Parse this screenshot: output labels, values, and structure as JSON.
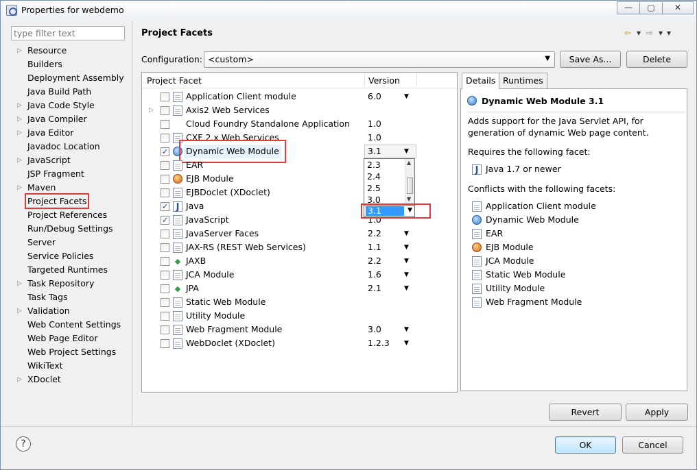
{
  "window": {
    "title": "Properties for webdemo",
    "controls": {
      "minimize": "—",
      "maximize": "▢",
      "close": "✕"
    }
  },
  "filter": {
    "placeholder": "type filter text"
  },
  "nav": {
    "items": [
      {
        "label": "Resource",
        "expandable": true
      },
      {
        "label": "Builders",
        "expandable": false
      },
      {
        "label": "Deployment Assembly",
        "expandable": false
      },
      {
        "label": "Java Build Path",
        "expandable": false
      },
      {
        "label": "Java Code Style",
        "expandable": true
      },
      {
        "label": "Java Compiler",
        "expandable": true
      },
      {
        "label": "Java Editor",
        "expandable": true
      },
      {
        "label": "Javadoc Location",
        "expandable": false
      },
      {
        "label": "JavaScript",
        "expandable": true
      },
      {
        "label": "JSP Fragment",
        "expandable": false
      },
      {
        "label": "Maven",
        "expandable": true
      },
      {
        "label": "Project Facets",
        "expandable": false,
        "selected": true
      },
      {
        "label": "Project References",
        "expandable": false
      },
      {
        "label": "Run/Debug Settings",
        "expandable": false
      },
      {
        "label": "Server",
        "expandable": false
      },
      {
        "label": "Service Policies",
        "expandable": false
      },
      {
        "label": "Targeted Runtimes",
        "expandable": false
      },
      {
        "label": "Task Repository",
        "expandable": true
      },
      {
        "label": "Task Tags",
        "expandable": false
      },
      {
        "label": "Validation",
        "expandable": true
      },
      {
        "label": "Web Content Settings",
        "expandable": false
      },
      {
        "label": "Web Page Editor",
        "expandable": false
      },
      {
        "label": "Web Project Settings",
        "expandable": false
      },
      {
        "label": "WikiText",
        "expandable": false
      },
      {
        "label": "XDoclet",
        "expandable": true
      }
    ]
  },
  "page": {
    "title": "Project Facets",
    "nav_arrows": {
      "back": "⇦",
      "forward": "⇨",
      "caret": "▾",
      "menu": "▾"
    }
  },
  "configuration": {
    "label": "Configuration:",
    "value": "<custom>",
    "save_as": "Save As...",
    "delete": "Delete"
  },
  "facets": {
    "columns": {
      "facet": "Project Facet",
      "version": "Version"
    },
    "rows": [
      {
        "name": "Application Client module",
        "version": "6.0",
        "checked": false,
        "icon": "doc",
        "dropdown": true,
        "expandable": false
      },
      {
        "name": "Axis2 Web Services",
        "version": "",
        "checked": false,
        "icon": "doc",
        "dropdown": false,
        "expandable": true
      },
      {
        "name": "Cloud Foundry Standalone Application",
        "version": "1.0",
        "checked": false,
        "icon": "none",
        "dropdown": false,
        "expandable": false
      },
      {
        "name": "CXF 2.x Web Services",
        "version": "1.0",
        "checked": false,
        "icon": "doc",
        "dropdown": false,
        "expandable": false
      },
      {
        "name": "Dynamic Web Module",
        "version": "3.1",
        "checked": true,
        "icon": "globe",
        "dropdown": true,
        "expandable": false,
        "selected": true
      },
      {
        "name": "EAR",
        "version": "",
        "checked": false,
        "icon": "doc",
        "dropdown": false,
        "expandable": false
      },
      {
        "name": "EJB Module",
        "version": "",
        "checked": false,
        "icon": "bean",
        "dropdown": false,
        "expandable": false
      },
      {
        "name": "EJBDoclet (XDoclet)",
        "version": "",
        "checked": false,
        "icon": "doc",
        "dropdown": false,
        "expandable": false
      },
      {
        "name": "Java",
        "version": "",
        "checked": true,
        "icon": "java",
        "dropdown": false,
        "expandable": false
      },
      {
        "name": "JavaScript",
        "version": "1.0",
        "checked": true,
        "icon": "doc",
        "dropdown": false,
        "expandable": false
      },
      {
        "name": "JavaServer Faces",
        "version": "2.2",
        "checked": false,
        "icon": "doc",
        "dropdown": true,
        "expandable": false
      },
      {
        "name": "JAX-RS (REST Web Services)",
        "version": "1.1",
        "checked": false,
        "icon": "doc",
        "dropdown": true,
        "expandable": false
      },
      {
        "name": "JAXB",
        "version": "2.2",
        "checked": false,
        "icon": "arrows",
        "dropdown": true,
        "expandable": false
      },
      {
        "name": "JCA Module",
        "version": "1.6",
        "checked": false,
        "icon": "doc",
        "dropdown": true,
        "expandable": false
      },
      {
        "name": "JPA",
        "version": "2.1",
        "checked": false,
        "icon": "arrows",
        "dropdown": true,
        "expandable": false
      },
      {
        "name": "Static Web Module",
        "version": "",
        "checked": false,
        "icon": "doc",
        "dropdown": false,
        "expandable": false
      },
      {
        "name": "Utility Module",
        "version": "",
        "checked": false,
        "icon": "doc",
        "dropdown": false,
        "expandable": false
      },
      {
        "name": "Web Fragment Module",
        "version": "3.0",
        "checked": false,
        "icon": "doc",
        "dropdown": true,
        "expandable": false
      },
      {
        "name": "WebDoclet (XDoclet)",
        "version": "1.2.3",
        "checked": false,
        "icon": "doc",
        "dropdown": true,
        "expandable": false
      }
    ],
    "version_dropdown": {
      "options": [
        "2.3",
        "2.4",
        "2.5",
        "3.0"
      ],
      "selected": "3.1"
    }
  },
  "details": {
    "tabs": {
      "details": "Details",
      "runtimes": "Runtimes"
    },
    "title": "Dynamic Web Module 3.1",
    "description": "Adds support for the Java Servlet API, for generation of dynamic Web page content.",
    "requires_label": "Requires the following facet:",
    "requires": [
      {
        "label": "Java 1.7 or newer",
        "icon": "java"
      }
    ],
    "conflicts_label": "Conflicts with the following facets:",
    "conflicts": [
      {
        "label": "Application Client module",
        "icon": "doc"
      },
      {
        "label": "Dynamic Web Module",
        "icon": "globe"
      },
      {
        "label": "EAR",
        "icon": "doc"
      },
      {
        "label": "EJB Module",
        "icon": "bean"
      },
      {
        "label": "JCA Module",
        "icon": "doc"
      },
      {
        "label": "Static Web Module",
        "icon": "doc"
      },
      {
        "label": "Utility Module",
        "icon": "doc"
      },
      {
        "label": "Web Fragment Module",
        "icon": "doc"
      }
    ]
  },
  "buttons": {
    "revert": "Revert",
    "apply": "Apply",
    "ok": "OK",
    "cancel": "Cancel",
    "help": "?"
  },
  "colors": {
    "highlight": "#e03c3c",
    "selection": "#3399ff",
    "window_bg": "#f0f0f0"
  }
}
